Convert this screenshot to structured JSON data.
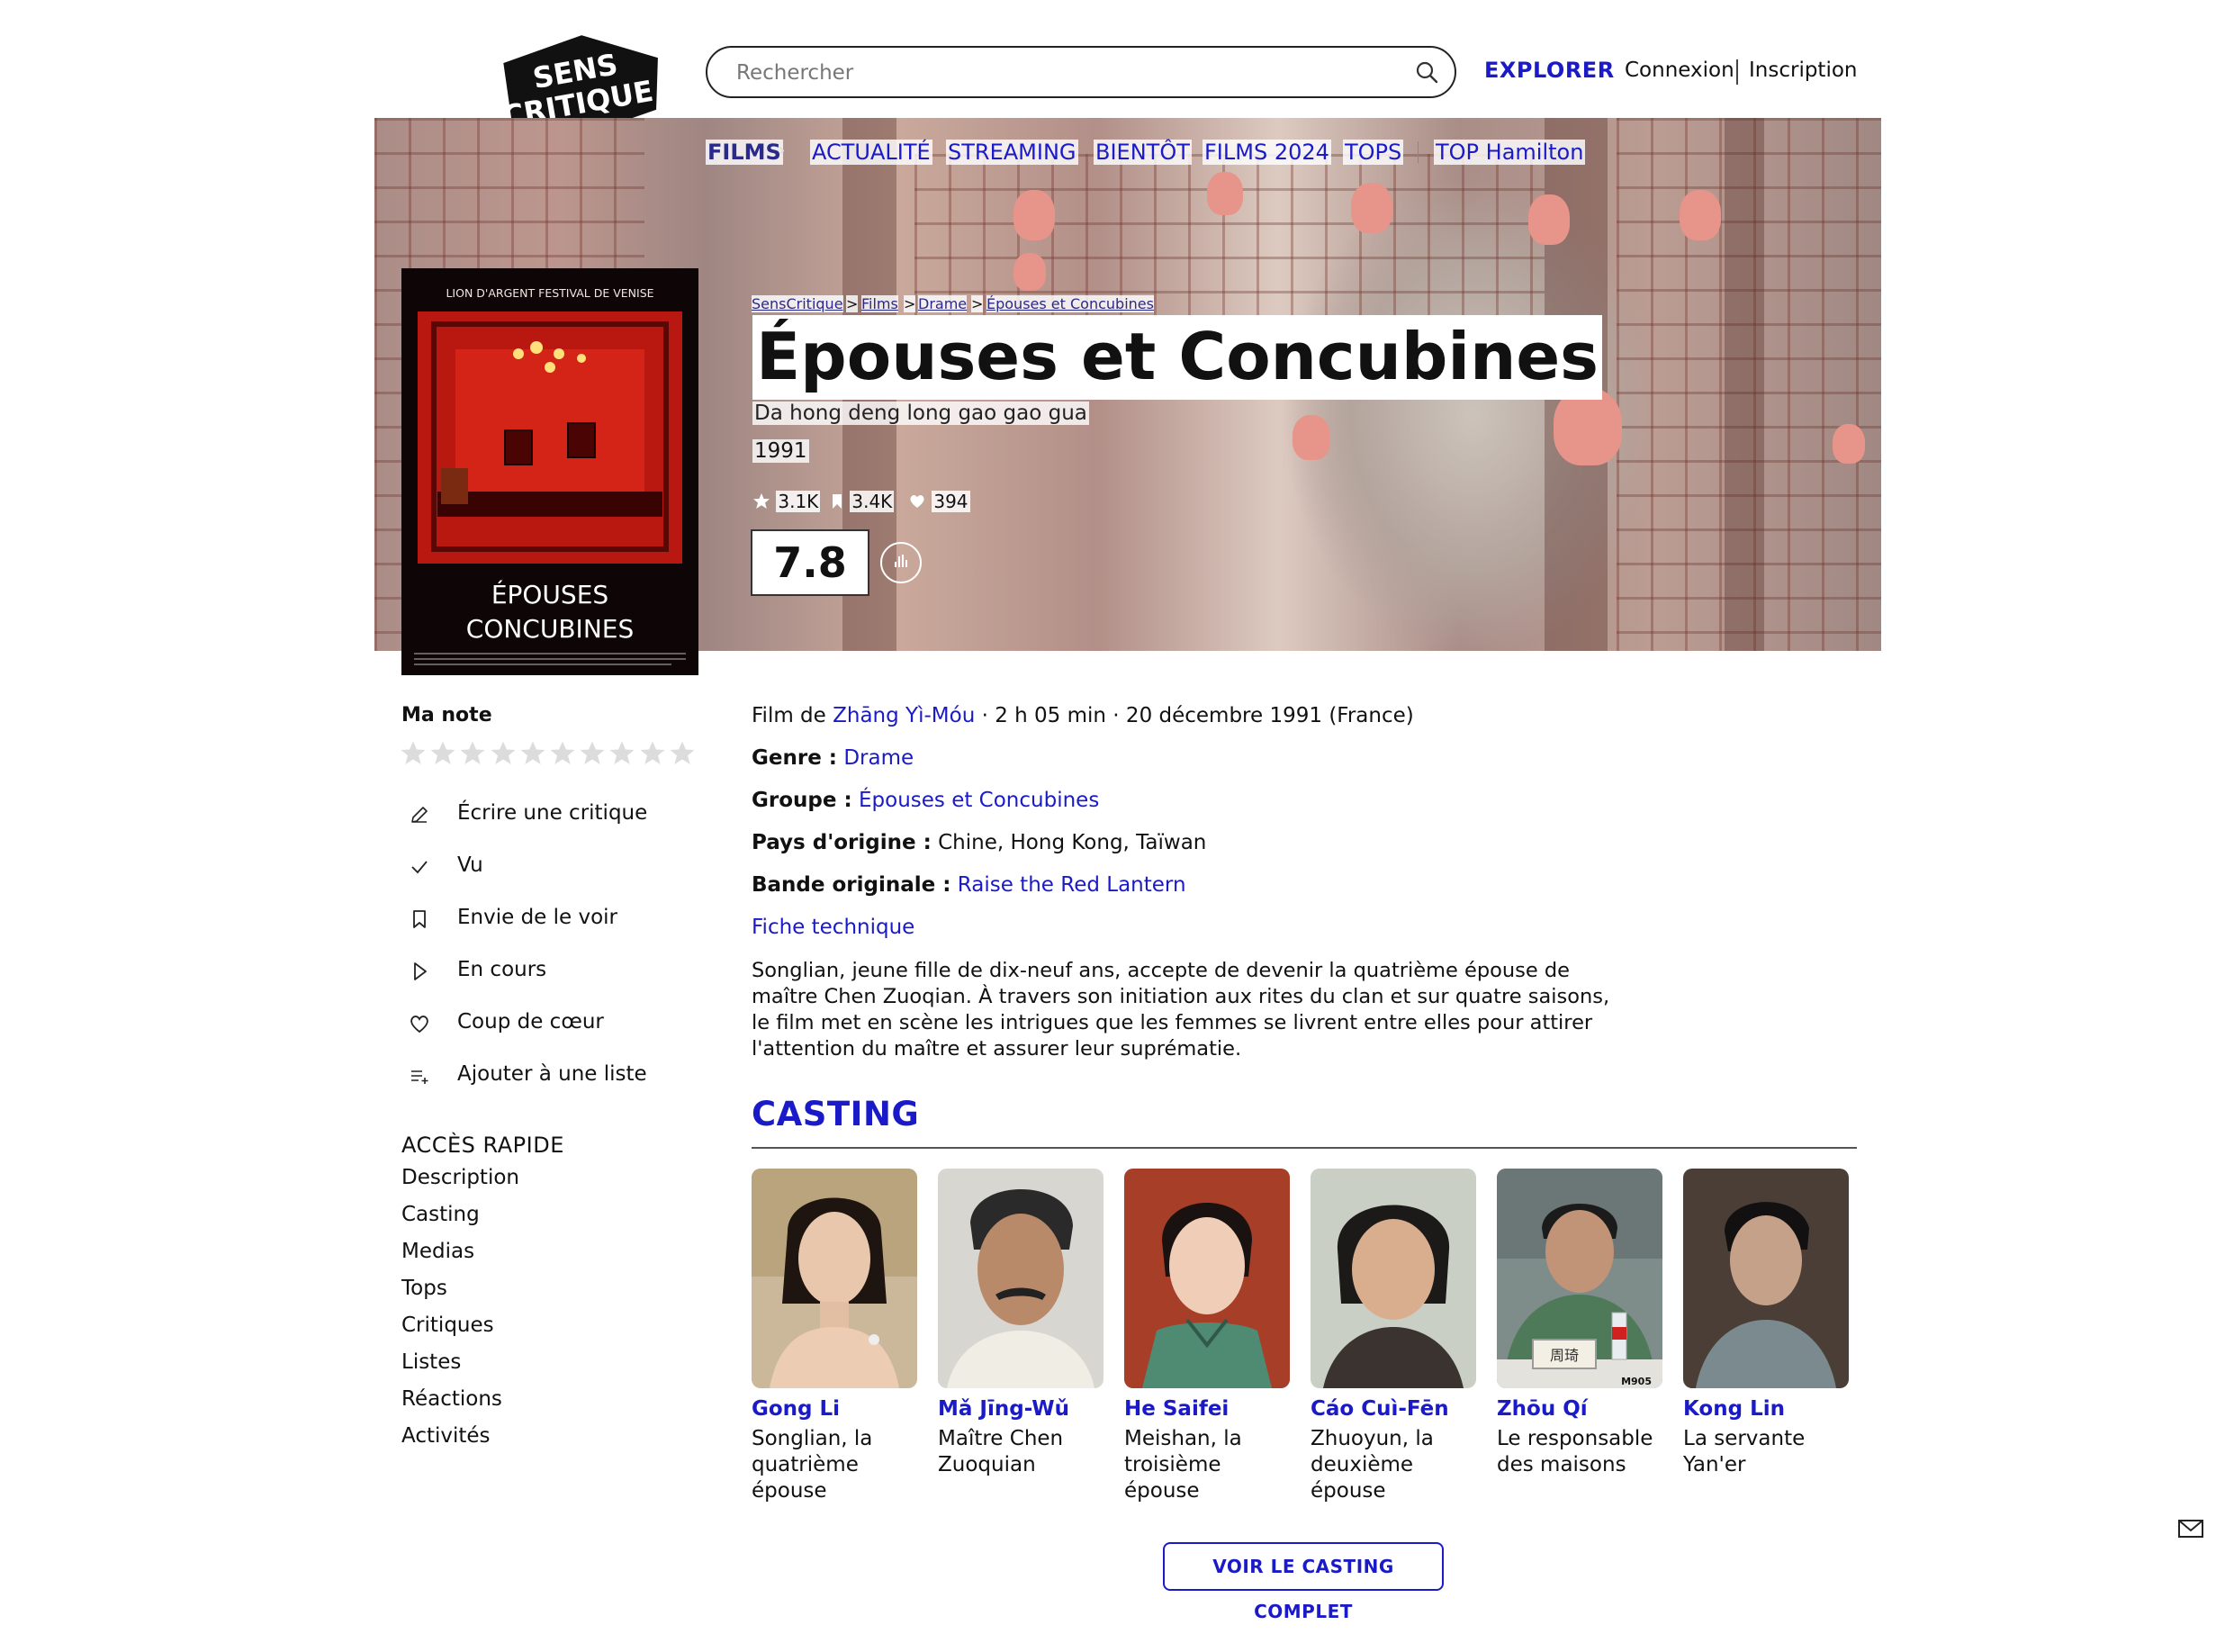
{
  "header": {
    "logo_line1": "SENS",
    "logo_line2": "CRITIQUE",
    "search_placeholder": "Rechercher",
    "explorer": "EXPLORER",
    "login": "Connexion",
    "signup": "Inscription"
  },
  "nav": {
    "films": "FILMS",
    "items": [
      "ACTUALITÉ",
      "STREAMING",
      "BIENTÔT",
      "FILMS 2024",
      "TOPS"
    ],
    "top": "TOP Hamilton"
  },
  "breadcrumb": [
    "SensCritique",
    "Films",
    "Drame",
    "Épouses et Concubines"
  ],
  "film": {
    "title": "Épouses et Concubines",
    "original_title": "Da hong deng long gao gao gua",
    "year": "1991",
    "ratings_count": "3.1K",
    "wishlist_count": "3.4K",
    "favorites_count": "394",
    "score": "7.8",
    "poster": {
      "festival": "LION D'ARGENT FESTIVAL DE VENISE",
      "title_line1": "ÉPOUSES",
      "title_line2": "CONCUBINES"
    }
  },
  "sidebar": {
    "my_rating": "Ma note",
    "star_count": 10,
    "actions": [
      {
        "label": "Écrire une critique",
        "icon": "pencil-icon"
      },
      {
        "label": "Vu",
        "icon": "check-icon"
      },
      {
        "label": "Envie de le voir",
        "icon": "bookmark-icon"
      },
      {
        "label": "En cours",
        "icon": "play-icon"
      },
      {
        "label": "Coup de cœur",
        "icon": "heart-icon"
      },
      {
        "label": "Ajouter à une liste",
        "icon": "add-list-icon"
      }
    ],
    "quick_access_title": "ACCÈS RAPIDE",
    "quick_access": [
      "Description",
      "Casting",
      "Medias",
      "Tops",
      "Critiques",
      "Listes",
      "Réactions",
      "Activités"
    ]
  },
  "details": {
    "film_de": "Film de ",
    "director": "Zhāng Yì-Móu",
    "meta_rest": " · 2 h 05 min · 20 décembre 1991 (France)",
    "genre_label": "Genre :",
    "genre": "Drame",
    "group_label": "Groupe :",
    "group": "Épouses et Concubines",
    "country_label": "Pays d'origine :",
    "countries": "Chine, Hong Kong, Taïwan",
    "soundtrack_label": "Bande originale :",
    "soundtrack": "Raise the Red Lantern",
    "tech_sheet": "Fiche technique",
    "synopsis": "Songlian, jeune fille de dix-neuf ans, accepte de devenir la quatrième épouse de maître Chen Zuoqian. À travers son initiation aux rites du clan et sur quatre saisons, le film met en scène les intrigues que les femmes se livrent entre elles pour attirer l'attention du maître et assurer leur suprématie."
  },
  "casting": {
    "title": "CASTING",
    "actors": [
      {
        "name": "Gong Li",
        "role": "Songlian, la quatrième épouse"
      },
      {
        "name": "Mǎ Jīng-Wǔ",
        "role": "Maître Chen Zuoquian"
      },
      {
        "name": "He Saifei",
        "role": "Meishan, la troisième épouse"
      },
      {
        "name": "Cáo Cuì-Fēn",
        "role": "Zhuoyun, la deuxième épouse"
      },
      {
        "name": "Zhōu Qí",
        "role": "Le responsable des maisons"
      },
      {
        "name": "Kong Lin",
        "role": "La servante Yan'er"
      }
    ],
    "photo_tag": "M905",
    "nameplate": "周琦",
    "full_cast_button": "VOIR LE CASTING COMPLET"
  },
  "colors": {
    "accent": "#1a1ac8",
    "poster_red": "#c01a12"
  }
}
